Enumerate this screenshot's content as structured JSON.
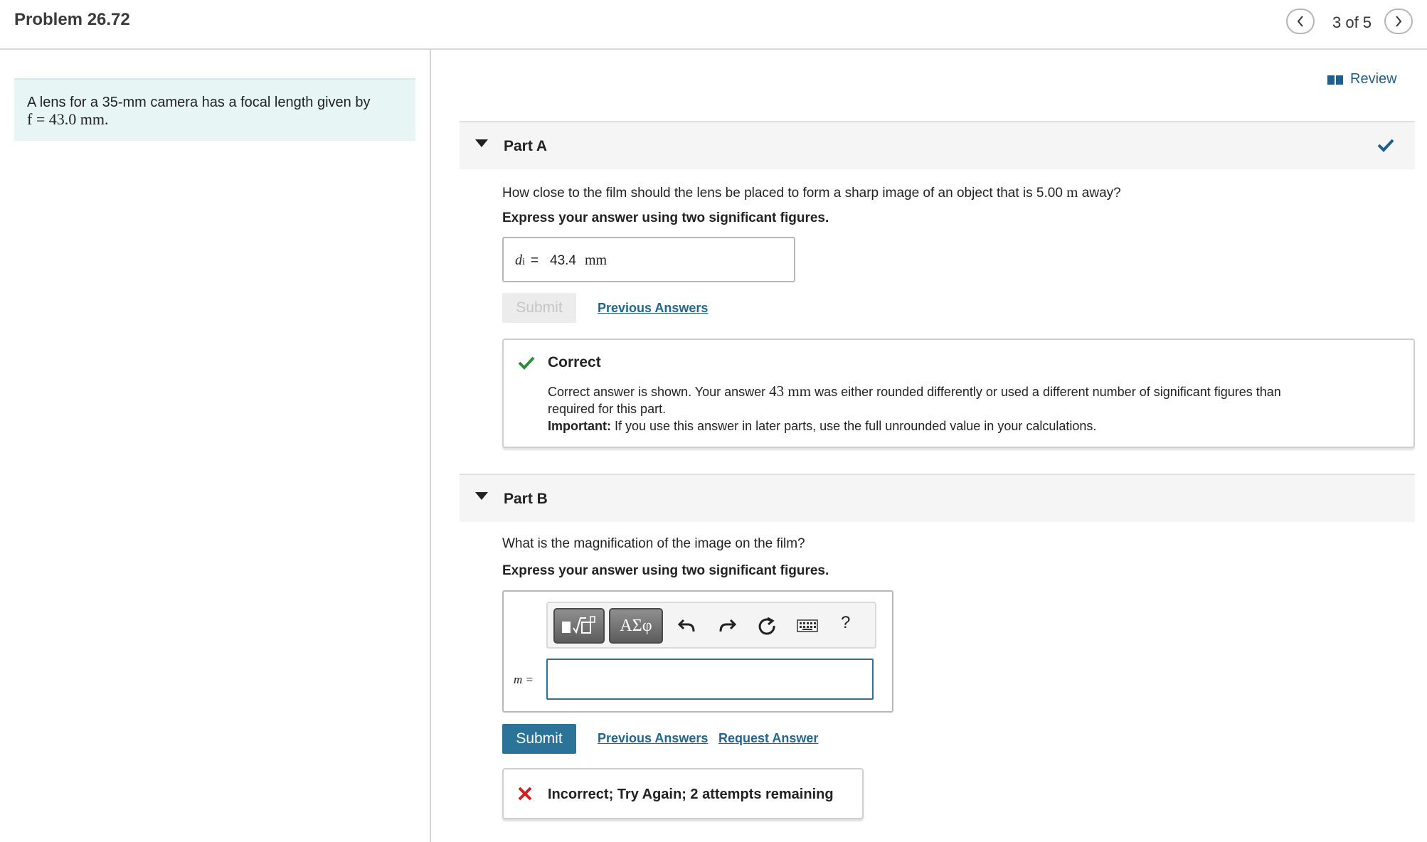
{
  "header": {
    "title": "Problem 26.72",
    "pager": "3 of 5"
  },
  "problem": {
    "line1": "A lens for a 35-mm camera has a focal length given by",
    "line2": "f = 43.0 mm."
  },
  "review": {
    "label": "Review"
  },
  "partA": {
    "label": "Part A",
    "question_pre": "How close to the film should the lens be placed to form a sharp image of an object that is 5.00 ",
    "question_unit": "m",
    "question_post": " away?",
    "instruction": "Express your answer using two significant figures.",
    "var_name": "d",
    "var_sub": "i",
    "equals": "=",
    "answer_value": "43.4",
    "answer_unit": "mm",
    "submit_label": "Submit",
    "previous_answers": "Previous Answers",
    "feedback": {
      "title": "Correct",
      "line1_pre": "Correct answer is shown. Your answer ",
      "line1_value": "43 mm",
      "line1_post": " was either rounded differently or used a different number of significant figures than",
      "line2": "required for this part.",
      "important_label": "Important:",
      "important_text": " If you use this answer in later parts, use the full unrounded value in your calculations."
    }
  },
  "partB": {
    "label": "Part B",
    "question": "What is the magnification of the image on the film?",
    "instruction": "Express your answer using two significant figures.",
    "var_label": "m =",
    "input_value": "",
    "toolbar": {
      "templates_icon": "templates-icon",
      "greek_label": "ΑΣφ",
      "undo_icon": "undo-icon",
      "redo_icon": "redo-icon",
      "reset_icon": "reset-icon",
      "keyboard_icon": "keyboard-icon",
      "help_label": "?"
    },
    "submit_label": "Submit",
    "previous_answers": "Previous Answers",
    "request_answer": "Request Answer",
    "feedback": {
      "text": "Incorrect; Try Again; 2 attempts remaining"
    }
  },
  "colors": {
    "accent": "#2b7399",
    "correct": "#2e8b3a",
    "incorrect": "#d21f1f",
    "problem_bg": "#e8f5f5"
  }
}
